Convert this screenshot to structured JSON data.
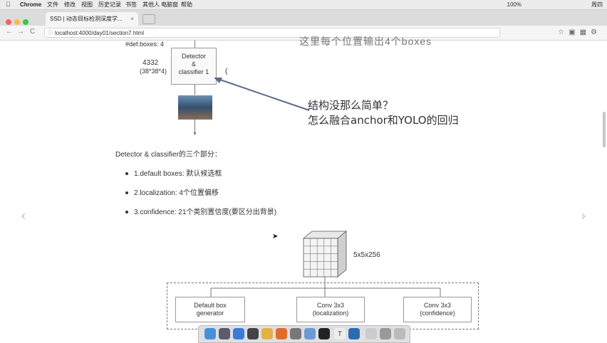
{
  "menubar": {
    "apple": "",
    "app_name": "Chrome",
    "items": [
      "文件",
      "修改",
      "视图",
      "历史记录",
      "书签",
      "其他人",
      "电脑窗",
      "帮助"
    ],
    "battery": "100%",
    "right_text": "周四"
  },
  "browser": {
    "tab_title": "SSD | 动态目标检测深度学...",
    "tab_close": "×",
    "url": "localhost:4000/day01/section7.html",
    "nav_back": "←",
    "nav_forward": "→",
    "nav_reload": "C"
  },
  "slide": {
    "top_label": "#def.boxes: 4",
    "left_num": "4332",
    "left_dims": "(38*38*4)",
    "detector_box": "Detector\n&\nclassifier 1",
    "top_heading": "这里每个位置输出4个boxes",
    "annotation_line1": "结构没那么简单？",
    "annotation_line2": "怎么融合anchor和YOLO的回归",
    "section_title": "Detector & classifier的三个部分：",
    "bullets": [
      "1.default boxes: 默认候选框",
      "2.localization: 4个位置偏移",
      "3.confidence: 21个类别置信度(要区分出背景)"
    ],
    "cube_label": "5x5x256",
    "boxes": [
      "Default box\ngenerator",
      "Conv 3x3\n(localization)",
      "Conv 3x3\n(confidence)"
    ],
    "prev_arrow": "‹",
    "next_arrow": "›"
  },
  "colors": {
    "accent_blue": "#5b6b8a",
    "dashed": "#777777"
  }
}
